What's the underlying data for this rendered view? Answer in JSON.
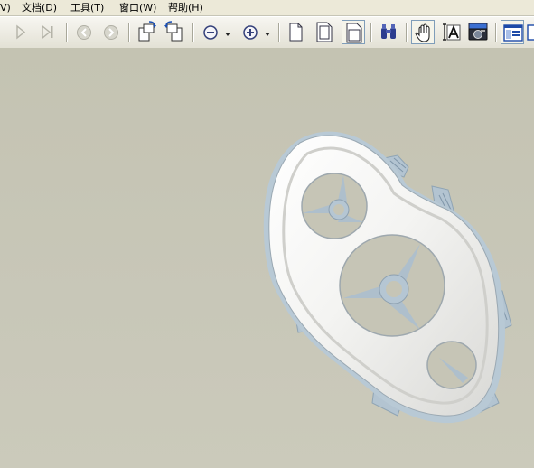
{
  "menu": {
    "items": [
      {
        "label": "V)"
      },
      {
        "label": "文档(D)"
      },
      {
        "label": "工具(T)"
      },
      {
        "label": "窗口(W)"
      },
      {
        "label": "帮助(H)"
      }
    ]
  },
  "toolbar": {
    "buttons": [
      {
        "name": "next-page-icon",
        "enabled": false
      },
      {
        "name": "last-page-icon",
        "enabled": false
      },
      {
        "name": "back-icon",
        "enabled": false
      },
      {
        "name": "forward-icon",
        "enabled": false
      },
      {
        "name": "rotate-clockwise-icon",
        "enabled": true
      },
      {
        "name": "rotate-counterclockwise-icon",
        "enabled": true
      },
      {
        "name": "zoom-out-icon",
        "enabled": true
      },
      {
        "name": "zoom-out-dropdown-icon",
        "enabled": true
      },
      {
        "name": "zoom-in-icon",
        "enabled": true
      },
      {
        "name": "zoom-in-dropdown-icon",
        "enabled": true
      },
      {
        "name": "actual-size-icon",
        "enabled": true
      },
      {
        "name": "fit-page-icon",
        "enabled": true
      },
      {
        "name": "fit-width-icon",
        "enabled": true,
        "pressed": true
      },
      {
        "name": "find-binoculars-icon",
        "enabled": true
      },
      {
        "name": "hand-tool-icon",
        "enabled": true,
        "pressed": true
      },
      {
        "name": "select-text-icon",
        "enabled": true
      },
      {
        "name": "snapshot-camera-icon",
        "enabled": true
      },
      {
        "name": "panels-icon",
        "enabled": true,
        "pressed": true
      }
    ]
  },
  "viewport": {
    "background_color": "#c6c5b6",
    "model_color": "#f2f2f0",
    "detail_color": "#b6c6d2"
  }
}
